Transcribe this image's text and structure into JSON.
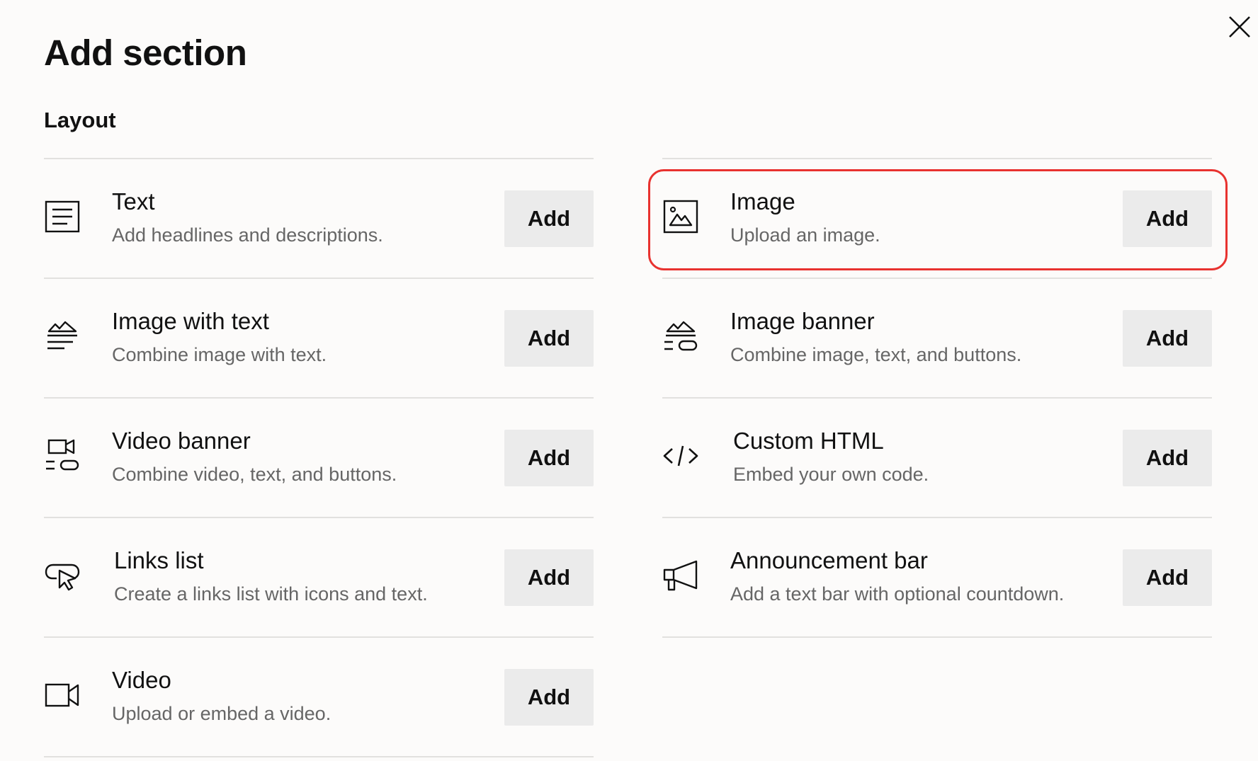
{
  "dialog": {
    "title": "Add section",
    "group_title": "Layout",
    "close_icon": "close-icon",
    "highlight_color": "#e8322f"
  },
  "sections_left": [
    {
      "title": "Text",
      "description": "Add headlines and descriptions.",
      "icon": "text-lines-icon",
      "button": "Add"
    },
    {
      "title": "Image with text",
      "description": "Combine image with text.",
      "icon": "image-with-text-icon",
      "button": "Add"
    },
    {
      "title": "Video banner",
      "description": "Combine video, text, and buttons.",
      "icon": "video-banner-icon",
      "button": "Add"
    },
    {
      "title": "Links list",
      "description": "Create a links list with icons and text.",
      "icon": "links-list-icon",
      "button": "Add"
    },
    {
      "title": "Video",
      "description": "Upload or embed a video.",
      "icon": "video-camera-icon",
      "button": "Add"
    }
  ],
  "sections_right": [
    {
      "title": "Image",
      "description": "Upload an image.",
      "icon": "image-icon",
      "button": "Add",
      "highlighted": true
    },
    {
      "title": "Image banner",
      "description": "Combine image, text, and buttons.",
      "icon": "image-banner-icon",
      "button": "Add"
    },
    {
      "title": "Custom HTML",
      "description": "Embed your own code.",
      "icon": "code-icon",
      "button": "Add"
    },
    {
      "title": "Announcement bar",
      "description": "Add a text bar with optional countdown.",
      "icon": "megaphone-icon",
      "button": "Add"
    }
  ]
}
